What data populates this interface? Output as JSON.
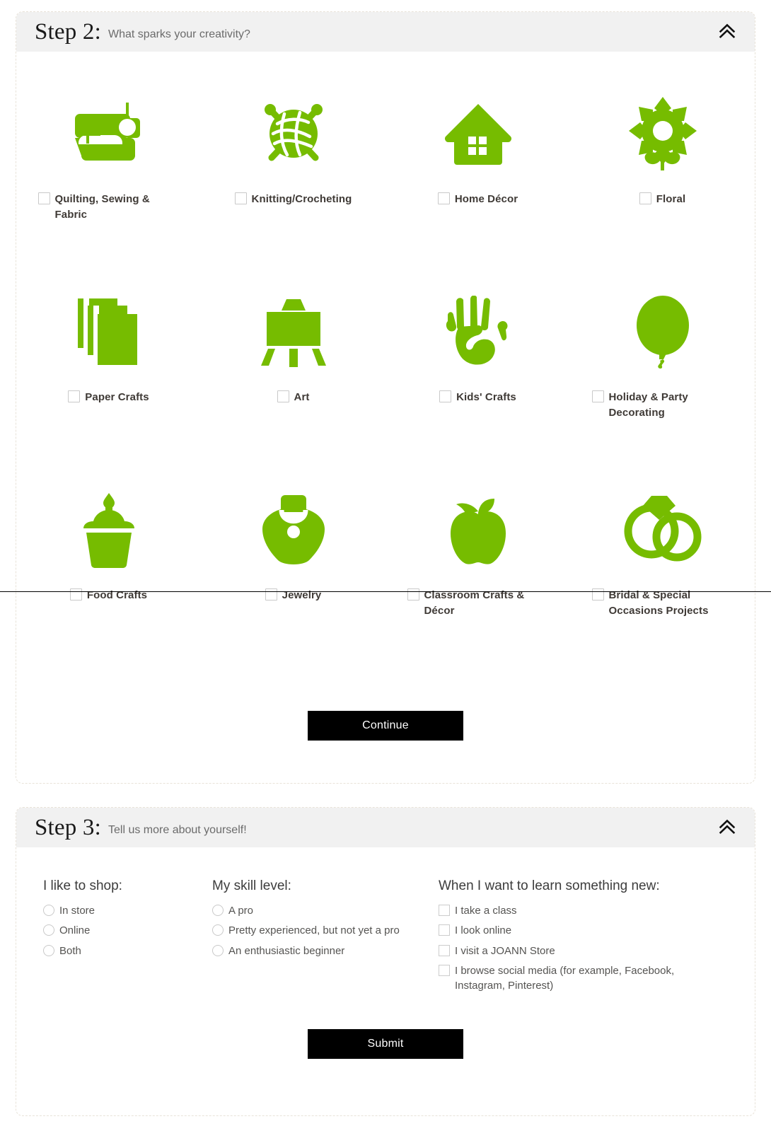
{
  "step2": {
    "title": "Step 2:",
    "subtitle": "What sparks your creativity?",
    "collapse_icon": "double-chevron-up-icon",
    "continue_label": "Continue",
    "tiles": [
      {
        "label": "Quilting, Sewing & Fabric",
        "icon": "sewing-machine-icon"
      },
      {
        "label": "Knitting/Crocheting",
        "icon": "yarn-ball-needles-icon"
      },
      {
        "label": "Home Décor",
        "icon": "house-icon"
      },
      {
        "label": "Floral",
        "icon": "flower-icon"
      },
      {
        "label": "Paper Crafts",
        "icon": "stacked-paper-icon"
      },
      {
        "label": "Art",
        "icon": "easel-icon"
      },
      {
        "label": "Kids' Crafts",
        "icon": "handprint-icon"
      },
      {
        "label": "Holiday & Party Decorating",
        "icon": "balloon-icon"
      },
      {
        "label": "Food Crafts",
        "icon": "cupcake-icon"
      },
      {
        "label": "Jewelry",
        "icon": "necklace-bust-icon"
      },
      {
        "label": "Classroom Crafts & Décor",
        "icon": "apple-icon"
      },
      {
        "label": "Bridal & Special Occasions Projects",
        "icon": "wedding-rings-icon"
      }
    ]
  },
  "step3": {
    "title": "Step 3:",
    "subtitle": "Tell us more about yourself!",
    "collapse_icon": "double-chevron-up-icon",
    "submit_label": "Submit",
    "shop": {
      "heading": "I like to shop:",
      "options": [
        "In store",
        "Online",
        "Both"
      ]
    },
    "skill": {
      "heading": "My skill level:",
      "options": [
        "A pro",
        "Pretty experienced, but not yet a pro",
        "An enthusiastic beginner"
      ]
    },
    "learn": {
      "heading": "When I want to learn something new:",
      "options": [
        "I take a class",
        "I look online",
        "I visit a JOANN Store",
        "I browse social media (for example, Facebook, Instagram, Pinterest)"
      ]
    }
  },
  "colors": {
    "brand_green": "#76bc00",
    "header_bg": "#f1f1f1",
    "card_border": "#e8e2d8",
    "button_bg": "#000000",
    "label_text": "#3f3a36",
    "muted_text": "#6b6b6b"
  }
}
